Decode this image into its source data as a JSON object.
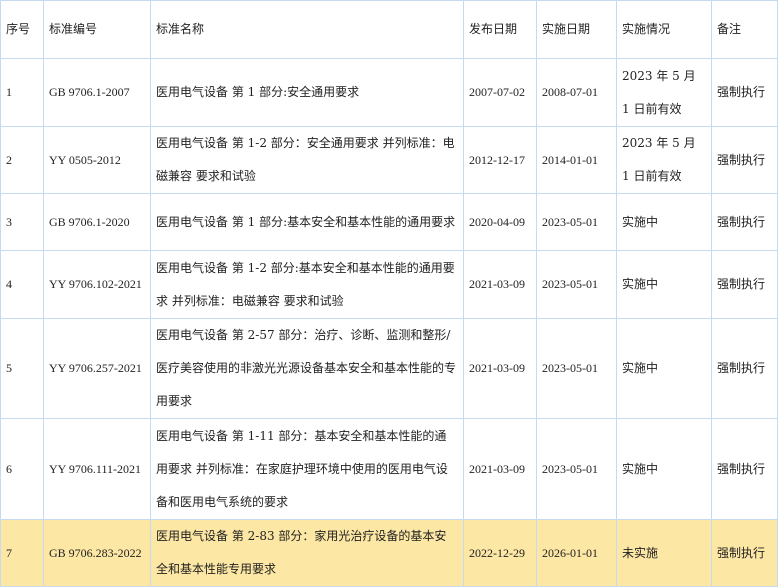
{
  "table": {
    "headers": [
      "序号",
      "标准编号",
      "标准名称",
      "发布日期",
      "实施日期",
      "实施情况",
      "备注"
    ],
    "rows": [
      {
        "index": "1",
        "code": "GB 9706.1-2007",
        "name": "医用电气设备 第 1 部分:安全通用要求",
        "published": "2007-07-02",
        "effective": "2008-07-01",
        "status": "2023 年 5 月 1 日前有效",
        "note": "强制执行",
        "highlighted": false
      },
      {
        "index": "2",
        "code": "YY 0505-2012",
        "name": "医用电气设备 第 1-2 部分：安全通用要求 并列标准：电磁兼容 要求和试验",
        "published": "2012-12-17",
        "effective": "2014-01-01",
        "status": "2023 年 5 月 1 日前有效",
        "note": "强制执行",
        "highlighted": false
      },
      {
        "index": "3",
        "code": "GB 9706.1-2020",
        "name": "医用电气设备 第 1 部分:基本安全和基本性能的通用要求",
        "published": "2020-04-09",
        "effective": "2023-05-01",
        "status": "实施中",
        "note": "强制执行",
        "highlighted": false
      },
      {
        "index": "4",
        "code": "YY 9706.102-2021",
        "name": "医用电气设备 第 1-2 部分:基本安全和基本性能的通用要求 并列标准：电磁兼容 要求和试验",
        "published": "2021-03-09",
        "effective": "2023-05-01",
        "status": "实施中",
        "note": "强制执行",
        "highlighted": false
      },
      {
        "index": "5",
        "code": "YY 9706.257-2021",
        "name": "医用电气设备 第 2-57 部分：治疗、诊断、监测和整形/医疗美容使用的非激光光源设备基本安全和基本性能的专用要求",
        "published": "2021-03-09",
        "effective": "2023-05-01",
        "status": "实施中",
        "note": "强制执行",
        "highlighted": false
      },
      {
        "index": "6",
        "code": "YY 9706.111-2021",
        "name": "医用电气设备 第 1-11 部分：基本安全和基本性能的通用要求 并列标准：在家庭护理环境中使用的医用电气设备和医用电气系统的要求",
        "published": "2021-03-09",
        "effective": "2023-05-01",
        "status": "实施中",
        "note": "强制执行",
        "highlighted": false
      },
      {
        "index": "7",
        "code": "GB 9706.283-2022",
        "name": "医用电气设备 第 2-83 部分：家用光治疗设备的基本安全和基本性能专用要求",
        "published": "2022-12-29",
        "effective": "2026-01-01",
        "status": "未实施",
        "note": "强制执行",
        "highlighted": true
      }
    ],
    "colors": {
      "border": "#c8daf0",
      "highlight_row": "#fde7a4",
      "text": "#222222"
    }
  }
}
